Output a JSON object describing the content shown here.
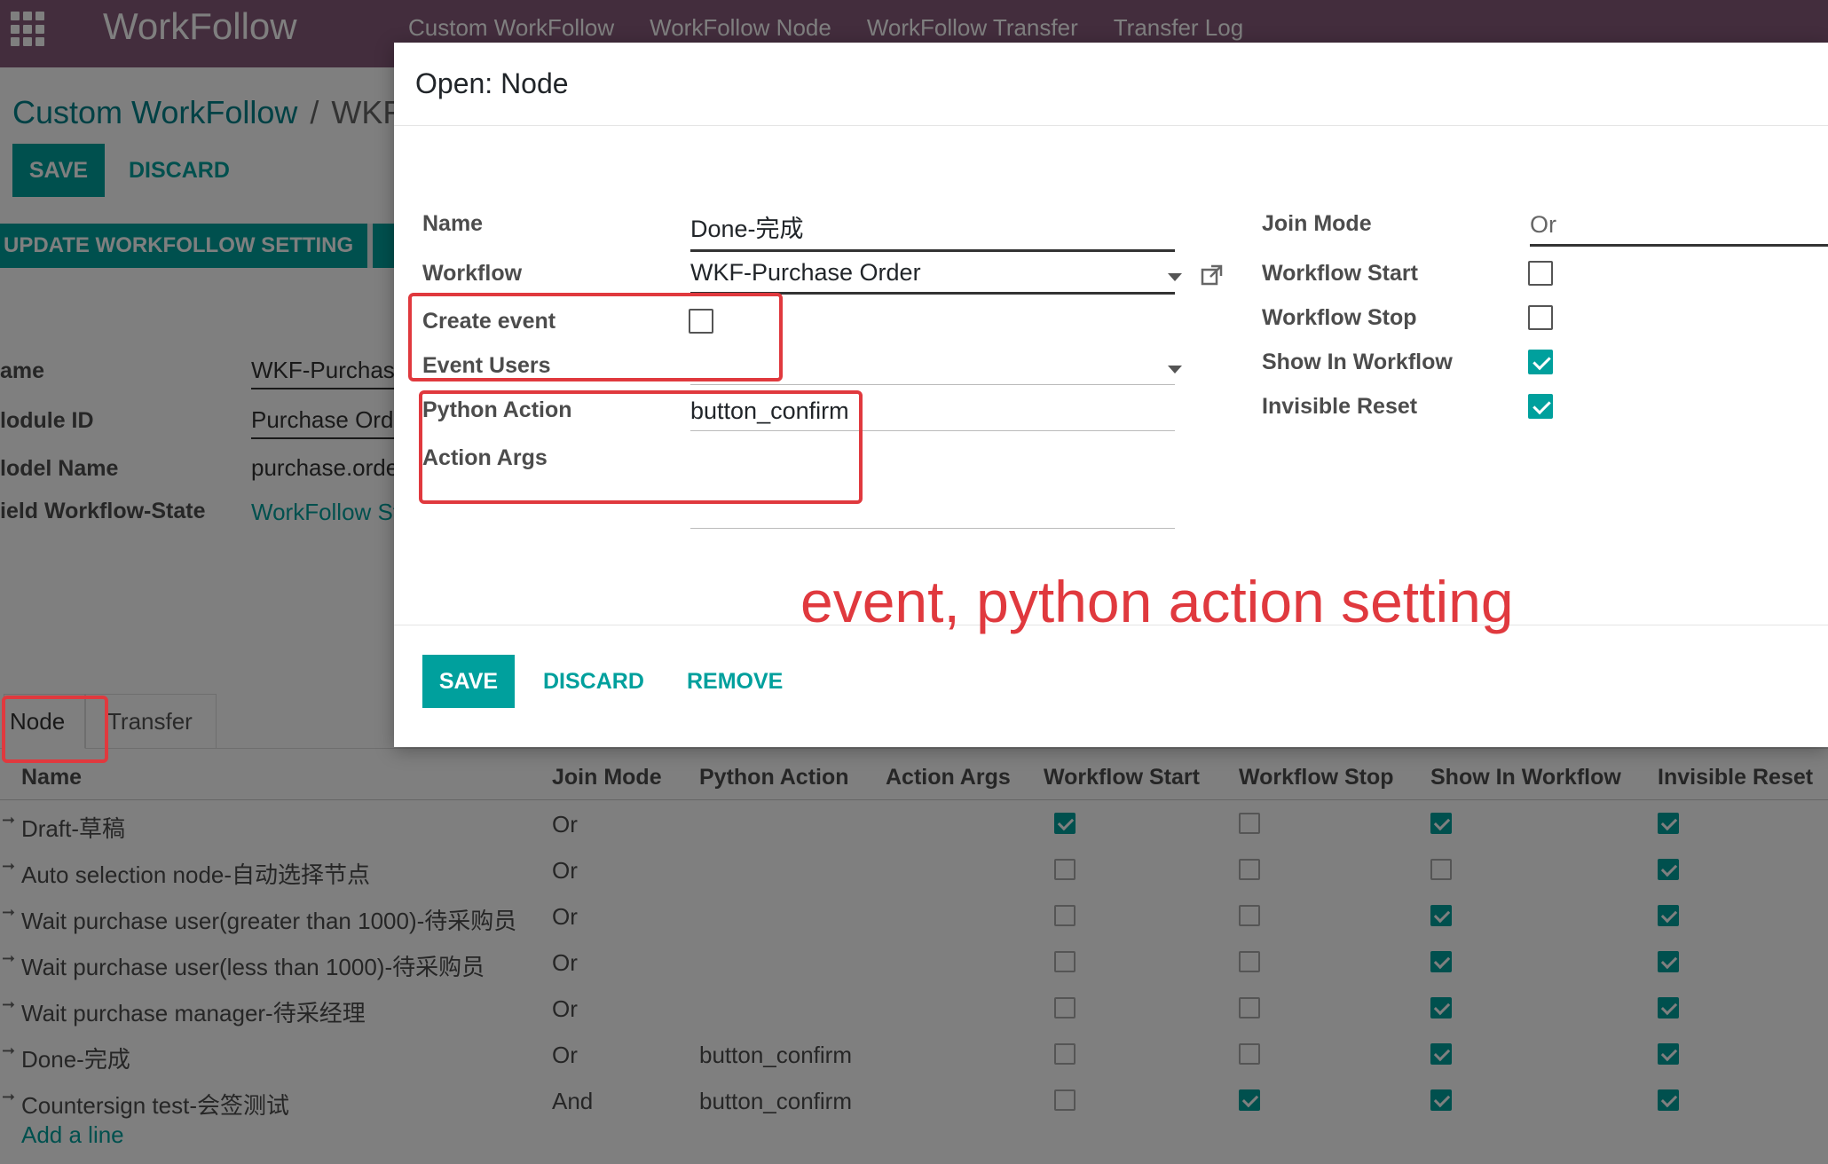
{
  "topnav": {
    "brand": "WorkFollow",
    "menu": [
      "Custom WorkFollow",
      "WorkFollow Node",
      "WorkFollow Transfer",
      "Transfer Log"
    ]
  },
  "page": {
    "breadcrumb": {
      "parent": "Custom WorkFollow",
      "separator": "/",
      "current": "WKF"
    },
    "save_label": "SAVE",
    "discard_label": "DISCARD",
    "update_button": "UPDATE WORKFOLLOW SETTING",
    "fields": [
      {
        "label": "ame",
        "value": "WKF-Purchas"
      },
      {
        "label": "lodule ID",
        "value": "Purchase Ord"
      },
      {
        "label": "lodel Name",
        "value": "purchase.orde"
      },
      {
        "label": "ield Workflow-State",
        "value": "WorkFollow St"
      }
    ],
    "tabs": [
      "Node",
      "Transfer"
    ],
    "table": {
      "columns": [
        "Name",
        "Join Mode",
        "Python Action",
        "Action Args",
        "Workflow Start",
        "Workflow Stop",
        "Show In Workflow",
        "Invisible Reset"
      ],
      "rows": [
        {
          "name": "Draft-草稿",
          "join": "Or",
          "python": "",
          "args": "",
          "start": true,
          "stop": false,
          "show": true,
          "reset": true
        },
        {
          "name": "Auto selection node-自动选择节点",
          "join": "Or",
          "python": "",
          "args": "",
          "start": false,
          "stop": false,
          "show": false,
          "reset": true
        },
        {
          "name": "Wait purchase user(greater than 1000)-待采购员",
          "join": "Or",
          "python": "",
          "args": "",
          "start": false,
          "stop": false,
          "show": true,
          "reset": true
        },
        {
          "name": "Wait purchase user(less than 1000)-待采购员",
          "join": "Or",
          "python": "",
          "args": "",
          "start": false,
          "stop": false,
          "show": true,
          "reset": true
        },
        {
          "name": "Wait purchase manager-待采经理",
          "join": "Or",
          "python": "",
          "args": "",
          "start": false,
          "stop": false,
          "show": true,
          "reset": true
        },
        {
          "name": "Done-完成",
          "join": "Or",
          "python": "button_confirm",
          "args": "",
          "start": false,
          "stop": false,
          "show": true,
          "reset": true
        },
        {
          "name": "Countersign test-会签测试",
          "join": "And",
          "python": "button_confirm",
          "args": "",
          "start": false,
          "stop": true,
          "show": true,
          "reset": true
        }
      ],
      "add_line": "Add a line"
    }
  },
  "modal": {
    "title": "Open: Node",
    "labels": {
      "name": "Name",
      "workflow": "Workflow",
      "create_event": "Create event",
      "event_users": "Event Users",
      "python_action": "Python Action",
      "action_args": "Action Args",
      "join_mode": "Join Mode",
      "workflow_start": "Workflow Start",
      "workflow_stop": "Workflow Stop",
      "show_in_workflow": "Show In Workflow",
      "invisible_reset": "Invisible Reset"
    },
    "values": {
      "name": "Done-完成",
      "workflow": "WKF-Purchase Order",
      "create_event": false,
      "event_users": "",
      "python_action": "button_confirm",
      "action_args": "",
      "join_mode": "Or",
      "workflow_start": false,
      "workflow_stop": false,
      "show_in_workflow": true,
      "invisible_reset": true
    },
    "buttons": {
      "save": "SAVE",
      "discard": "DISCARD",
      "remove": "REMOVE"
    }
  },
  "annotation": {
    "text": "event, python action  setting"
  },
  "colors": {
    "brand": "#875a7b",
    "accent": "#00a09d",
    "annotation": "#e0393e"
  }
}
